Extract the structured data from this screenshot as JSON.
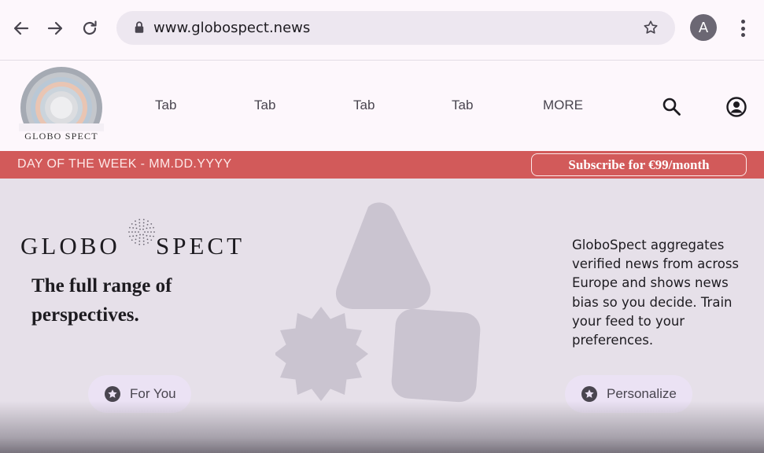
{
  "browser": {
    "url": "www.globospect.news",
    "avatar_letter": "A"
  },
  "header": {
    "logo_text": "GLOBO SPECT",
    "tabs": [
      "Tab",
      "Tab",
      "Tab",
      "Tab"
    ],
    "more_label": "MORE"
  },
  "banner": {
    "date_text": "DAY OF THE WEEK - MM.DD.YYYY",
    "subscribe_label": "Subscribe for €99/month"
  },
  "hero": {
    "brand_left": "GLOBO",
    "brand_right": "SPECT",
    "tagline": "The full range of perspectives.",
    "description": "GloboSpect aggregates verified news from across Europe and shows news bias so you decide. Train your feed to your preferences.",
    "for_you_label": "For You",
    "personalize_label": "Personalize"
  },
  "colors": {
    "banner": "#d25a5a",
    "page_bg": "#fdf7fc",
    "hero_bg": "#e6e0e9",
    "chip_bg": "#ebe2f4",
    "shape": "#cac4d0"
  }
}
